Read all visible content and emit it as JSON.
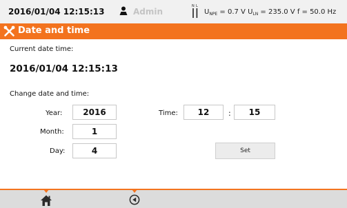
{
  "status": {
    "datetime": "2016/01/04 12:15:13",
    "user": "Admin",
    "nl_symbol": "N L",
    "measurements": {
      "u_npe_label": "U",
      "u_npe_sub": "NPE",
      "u_npe_value": " = 0.7 V ",
      "u_ln_label": "U",
      "u_ln_sub": "LN",
      "u_ln_value": " = 235.0 V ",
      "f_text": "f = 50.0 Hz"
    }
  },
  "title": {
    "text": "Date and time",
    "icon": "tools-icon"
  },
  "current": {
    "label": "Current date time:",
    "value": "2016/01/04 12:15:13"
  },
  "change": {
    "label": "Change date and time:",
    "year_label": "Year:",
    "year_value": "2016",
    "month_label": "Month:",
    "month_value": "1",
    "day_label": "Day:",
    "day_value": "4",
    "time_label": "Time:",
    "hour_value": "12",
    "separator": ":",
    "minute_value": "15",
    "set_label": "Set"
  },
  "bottom": {
    "home_icon": "home-icon",
    "back_icon": "back-icon"
  },
  "colors": {
    "accent": "#f3731e",
    "status_bg": "#f1f1f1",
    "bottom_bg": "#dcdcdc"
  }
}
